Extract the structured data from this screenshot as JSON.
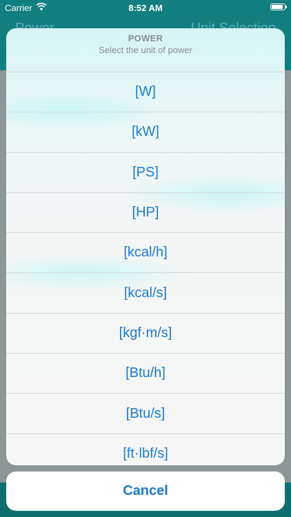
{
  "status_bar": {
    "carrier": "Carrier",
    "time": "8:52 AM"
  },
  "background_app": {
    "title_left": "Power",
    "title_right": "Unit Selection"
  },
  "sheet": {
    "title": "POWER",
    "subtitle": "Select the unit of power",
    "options": [
      "[W]",
      "[kW]",
      "[PS]",
      "[HP]",
      "[kcal/h]",
      "[kcal/s]",
      "[kgf·m/s]",
      "[Btu/h]",
      "[Btu/s]",
      "[ft·lbf/s]"
    ],
    "cancel_label": "Cancel"
  },
  "colors": {
    "accent": "#1a7bd6",
    "header_teal": "#117f80"
  }
}
